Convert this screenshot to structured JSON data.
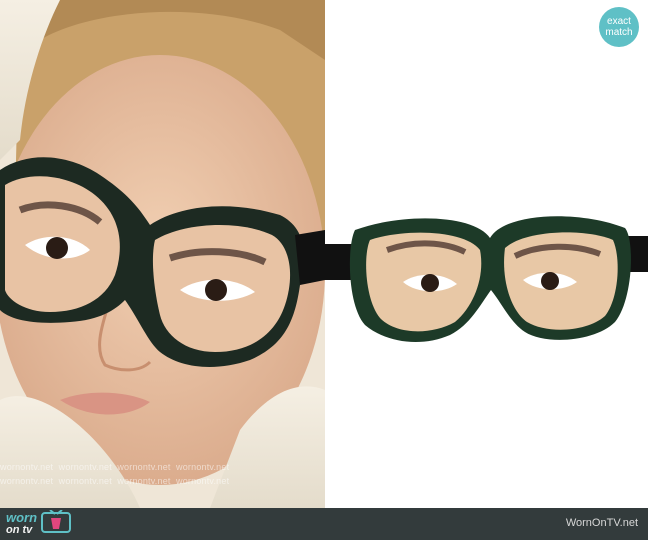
{
  "badge": {
    "line1": "exact",
    "line2": "match"
  },
  "watermark": {
    "text": "wornontv.net"
  },
  "footer": {
    "logo_top": "worn",
    "logo_bottom": "on tv",
    "site": "WornOnTV.net"
  },
  "colors": {
    "badge": "#5fc0c6",
    "footer_bg": "#333b3c",
    "mask_rim": "#1f3a2b"
  },
  "icons": [
    "tv-icon"
  ]
}
